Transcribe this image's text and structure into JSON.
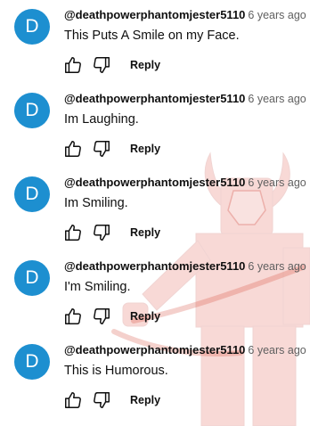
{
  "colors": {
    "avatar_bg": "#1d8fd0",
    "avatar_text": "#ffffff",
    "watermark": "#e0453a"
  },
  "icons": {
    "like": "thumb-up-icon",
    "dislike": "thumb-down-icon"
  },
  "comments": [
    {
      "avatar_letter": "D",
      "author": "@deathpowerphantomjester5110",
      "time": "6 years ago",
      "text": "This Puts A Smile on my Face.",
      "reply_label": "Reply"
    },
    {
      "avatar_letter": "D",
      "author": "@deathpowerphantomjester5110",
      "time": "6 years ago",
      "text": "Im Laughing.",
      "reply_label": "Reply"
    },
    {
      "avatar_letter": "D",
      "author": "@deathpowerphantomjester5110",
      "time": "6 years ago",
      "text": "Im Smiling.",
      "reply_label": "Reply"
    },
    {
      "avatar_letter": "D",
      "author": "@deathpowerphantomjester5110",
      "time": "6 years ago",
      "text": "I'm Smiling.",
      "reply_label": "Reply"
    },
    {
      "avatar_letter": "D",
      "author": "@deathpowerphantomjester5110",
      "time": "6 years ago",
      "text": "This is Humorous.",
      "reply_label": "Reply"
    }
  ]
}
